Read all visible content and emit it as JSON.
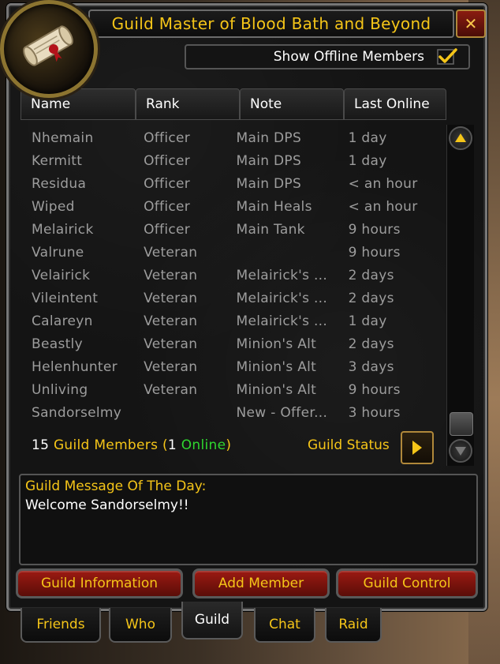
{
  "window": {
    "title": "Guild Master of Blood Bath and Beyond",
    "close_icon": "close-icon"
  },
  "offline_toggle": {
    "label": "Show Offline Members",
    "checked": true
  },
  "columns": [
    "Name",
    "Rank",
    "Note",
    "Last Online"
  ],
  "members": [
    {
      "name": "Nhemain",
      "rank": "Officer",
      "note": "Main DPS",
      "last": "1 day"
    },
    {
      "name": "Kermitt",
      "rank": "Officer",
      "note": "Main DPS",
      "last": "1 day"
    },
    {
      "name": "Residua",
      "rank": "Officer",
      "note": "Main DPS",
      "last": "< an hour"
    },
    {
      "name": "Wiped",
      "rank": "Officer",
      "note": "Main Heals",
      "last": "< an hour"
    },
    {
      "name": "Melairick",
      "rank": "Officer",
      "note": "Main Tank",
      "last": "9 hours"
    },
    {
      "name": "Valrune",
      "rank": "Veteran",
      "note": "",
      "last": "9 hours"
    },
    {
      "name": "Velairick",
      "rank": "Veteran",
      "note": "Melairick's ...",
      "last": "2 days"
    },
    {
      "name": "Vileintent",
      "rank": "Veteran",
      "note": "Melairick's ...",
      "last": "2 days"
    },
    {
      "name": "Calareyn",
      "rank": "Veteran",
      "note": "Melairick's ...",
      "last": "1 day"
    },
    {
      "name": "Beastly",
      "rank": "Veteran",
      "note": "Minion's Alt",
      "last": "2 days"
    },
    {
      "name": "Helenhunter",
      "rank": "Veteran",
      "note": "Minion's Alt",
      "last": "3 days"
    },
    {
      "name": "Unliving",
      "rank": "Veteran",
      "note": "Minion's Alt",
      "last": "9 hours"
    },
    {
      "name": "Sandorselmy",
      "rank": "",
      "note": "New - Offer...",
      "last": "3 hours"
    }
  ],
  "summary": {
    "count": "15",
    "members_label": "Guild Members",
    "open_paren": "(",
    "online_count": "1",
    "online_label": "Online",
    "close_paren": ")"
  },
  "guild_status": {
    "label": "Guild Status"
  },
  "motd": {
    "title": "Guild Message Of The Day:",
    "text": "Welcome Sandorselmy!!"
  },
  "actions": {
    "guild_information": "Guild Information",
    "add_member": "Add Member",
    "guild_control": "Guild Control"
  },
  "tabs": [
    "Friends",
    "Who",
    "Guild",
    "Chat",
    "Raid"
  ],
  "active_tab": "Guild",
  "colors": {
    "gold": "#f5c518",
    "online_green": "#2fd62f",
    "offline_grey": "#9d9d9d",
    "button_red": "#9c1a12"
  }
}
